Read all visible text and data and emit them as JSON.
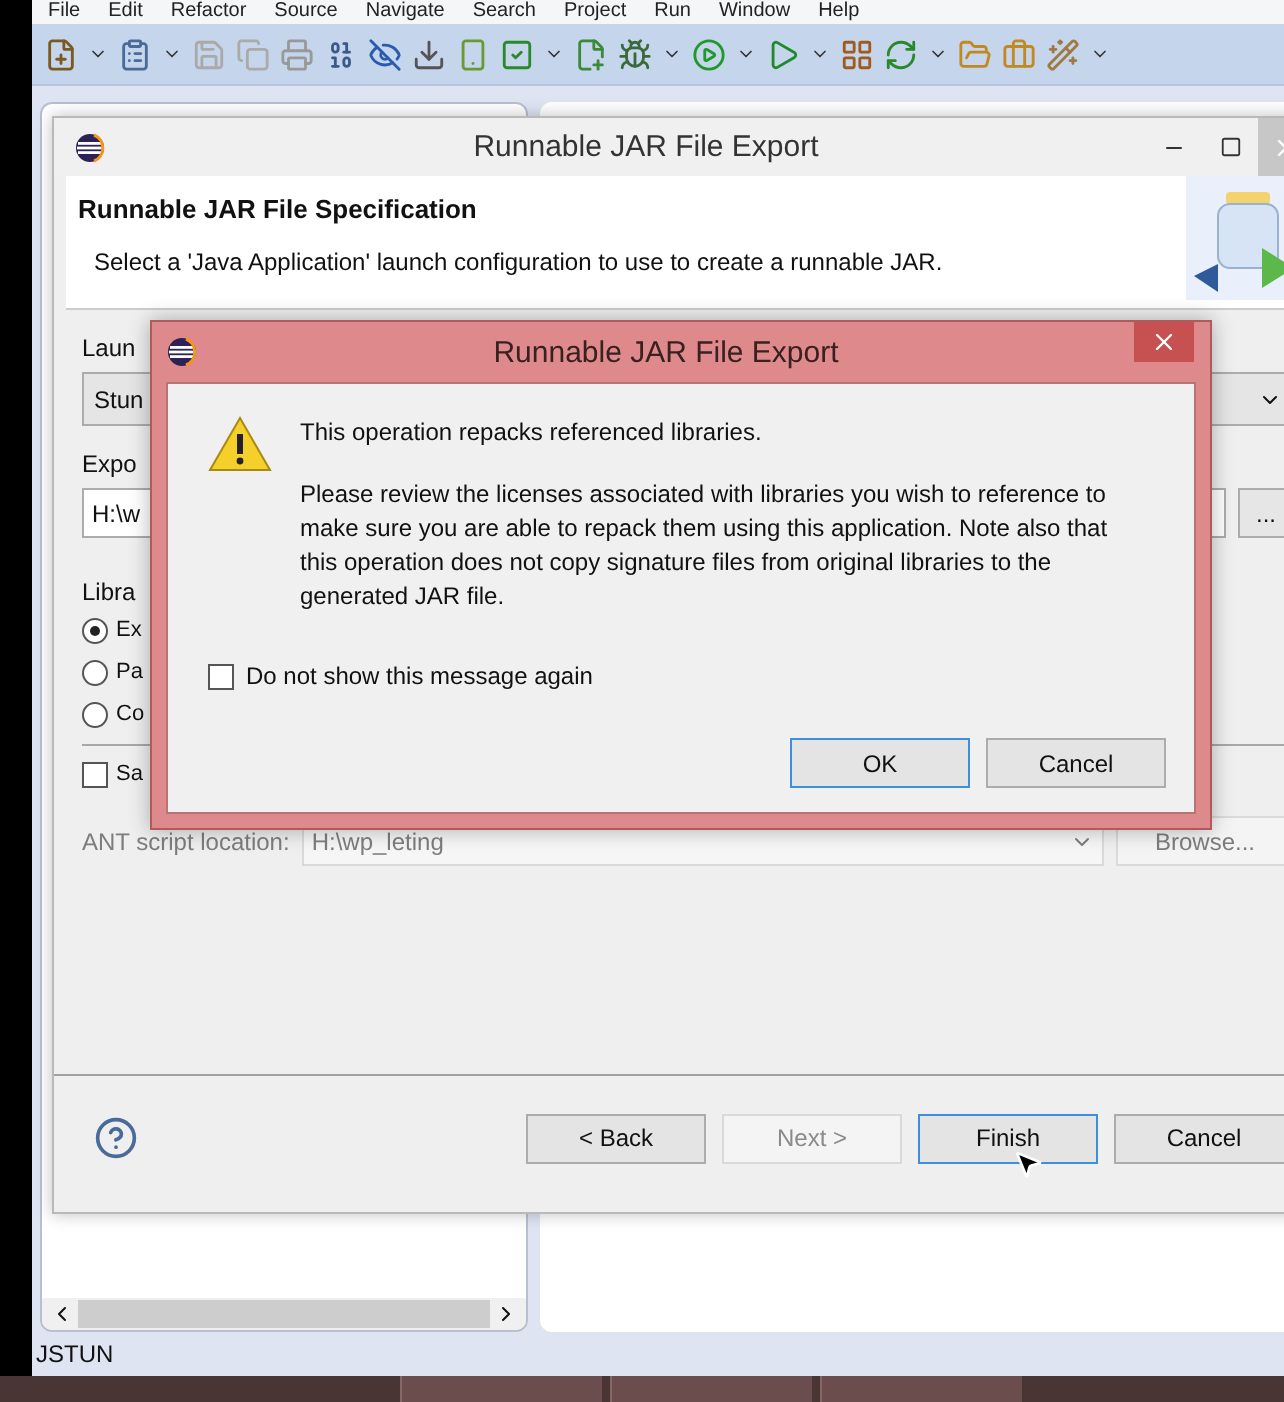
{
  "menu": [
    "File",
    "Edit",
    "Refactor",
    "Source",
    "Navigate",
    "Search",
    "Project",
    "Run",
    "Window",
    "Help"
  ],
  "wizard": {
    "title": "Runnable JAR File Export",
    "header_title": "Runnable JAR File Specification",
    "header_description": "Select a 'Java Application' launch configuration to use to create a runnable JAR.",
    "launch_label": "Laun",
    "launch_value": "Stun",
    "export_label": "Expo",
    "export_value": "H:\\w",
    "export_browse": "...",
    "library_label": "Libra",
    "library_options": [
      {
        "label": "Ex",
        "selected": true
      },
      {
        "label": "Pa",
        "selected": false
      },
      {
        "label": "Co",
        "selected": false
      }
    ],
    "save_option": {
      "label": "Sa",
      "checked": false
    },
    "ant_label": "ANT script location:",
    "ant_value": "H:\\wp_leting",
    "ant_browse": "Browse...",
    "ant_disabled": true,
    "buttons": [
      {
        "label": "< Back",
        "disabled": false,
        "default": false
      },
      {
        "label": "Next >",
        "disabled": true,
        "default": false
      },
      {
        "label": "Finish",
        "disabled": false,
        "default": true
      },
      {
        "label": "Cancel",
        "disabled": false,
        "default": false
      }
    ]
  },
  "dialog": {
    "title": "Runnable JAR File Export",
    "message": "This operation repacks referenced libraries.",
    "detail": "Please review the licenses associated with libraries you wish to reference to make sure you are able to repack them using this application. Note also that this operation does not copy signature files from original libraries to the generated JAR file.",
    "dont_show": {
      "label": "Do not show this message again",
      "checked": false
    },
    "buttons": [
      {
        "label": "OK",
        "default": true
      },
      {
        "label": "Cancel",
        "default": false
      }
    ]
  },
  "status_bar": "JSTUN"
}
